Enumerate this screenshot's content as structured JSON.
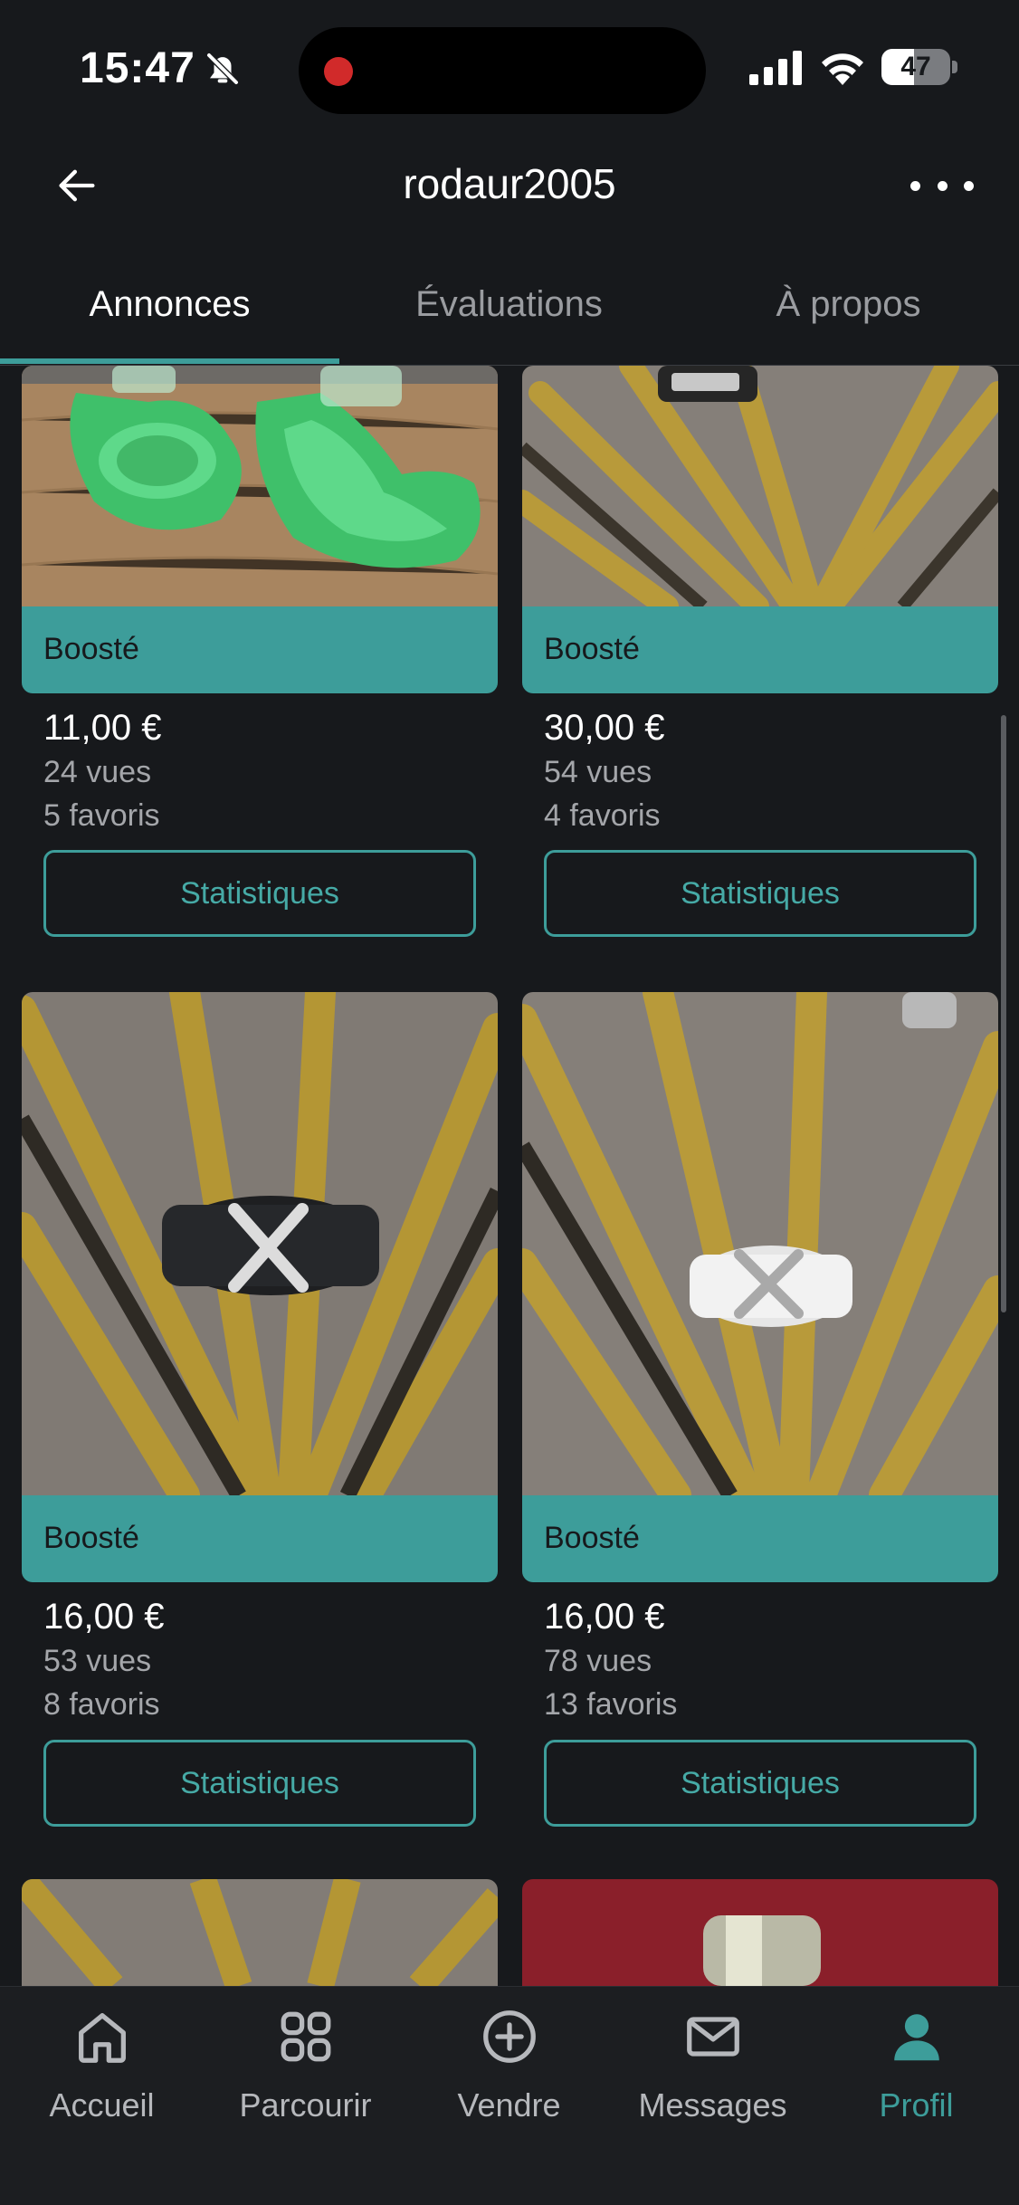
{
  "status_bar": {
    "time": "15:47",
    "battery": "47",
    "battery_level": 0.47
  },
  "header": {
    "title": "rodaur2005"
  },
  "tabs": [
    {
      "label": "Annonces",
      "active": true
    },
    {
      "label": "Évaluations",
      "active": false
    },
    {
      "label": "À propos",
      "active": false
    }
  ],
  "listings": [
    {
      "badge": "Boosté",
      "price": "11,00 €",
      "views": "24 vues",
      "favorites": "5 favoris",
      "button": "Statistiques",
      "image": "green-pet-bowls"
    },
    {
      "badge": "Boosté",
      "price": "30,00 €",
      "views": "54 vues",
      "favorites": "4 favoris",
      "button": "Statistiques",
      "image": "gold-metal-sculpture-ring"
    },
    {
      "badge": "Boosté",
      "price": "16,00 €",
      "views": "53 vues",
      "favorites": "8 favoris",
      "button": "Statistiques",
      "image": "black-ring-x"
    },
    {
      "badge": "Boosté",
      "price": "16,00 €",
      "views": "78 vues",
      "favorites": "13 favoris",
      "button": "Statistiques",
      "image": "white-ring-x"
    }
  ],
  "bottom_nav": [
    {
      "label": "Accueil",
      "icon": "home-icon",
      "active": false
    },
    {
      "label": "Parcourir",
      "icon": "grid-icon",
      "active": false
    },
    {
      "label": "Vendre",
      "icon": "plus-circle-icon",
      "active": false
    },
    {
      "label": "Messages",
      "icon": "mail-icon",
      "active": false
    },
    {
      "label": "Profil",
      "icon": "user-icon",
      "active": true
    }
  ],
  "colors": {
    "accent": "#3d9d9a",
    "background": "#17191c"
  }
}
